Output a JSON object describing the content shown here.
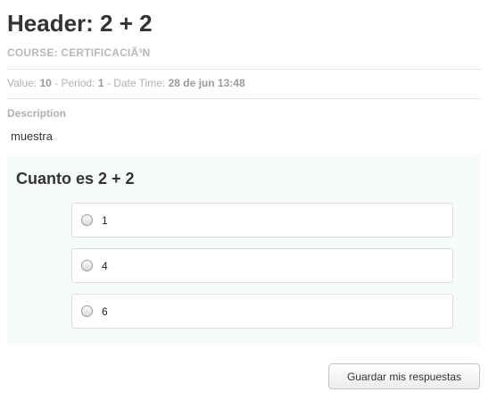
{
  "header": {
    "title": "Header: 2 + 2",
    "course": "COURSE: CERTIFICACIÃ³N"
  },
  "meta": {
    "value_label": "Value: ",
    "value": "10",
    "period_label": " - Period: ",
    "period": "1",
    "datetime_label": " - Date Time: ",
    "datetime": "28 de jun 13:48"
  },
  "description": {
    "label": "Description",
    "text": "muestra"
  },
  "question": {
    "title": "Cuanto es 2 + 2",
    "options": [
      {
        "label": "1",
        "selected": false
      },
      {
        "label": "4",
        "selected": false
      },
      {
        "label": "6",
        "selected": false
      }
    ]
  },
  "actions": {
    "submit_label": "Guardar mis respuestas"
  }
}
